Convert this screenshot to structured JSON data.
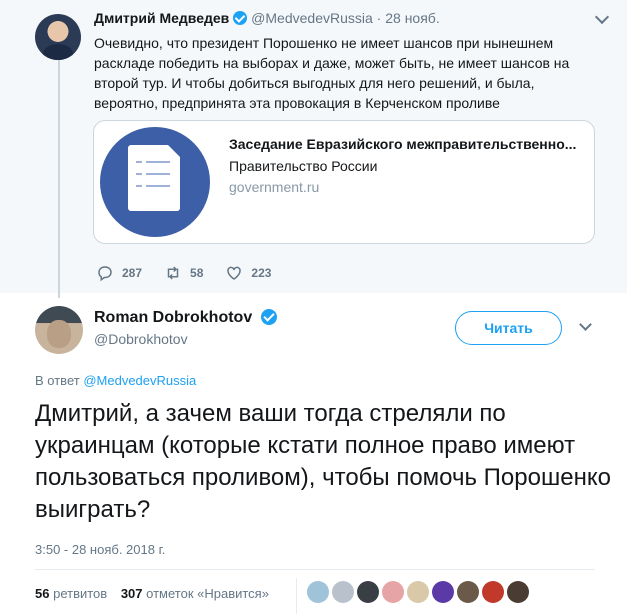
{
  "parent_tweet": {
    "name": "Дмитрий Медведев",
    "handle": "@MedvedevRussia",
    "separator": "·",
    "date": "28 нояб.",
    "text": "Очевидно, что президент Порошенко не имеет шансов при нынешнем раскладе победить на выборах и даже, может быть, не имеет шансов на второй тур. И чтобы добиться выгодных для него решений, и была, вероятно, предпринята эта провокация в Керченском проливе",
    "card": {
      "title": "Заседание Евразийского межправительственно...",
      "description": "Правительство России",
      "domain": "government.ru"
    },
    "actions": {
      "replies": "287",
      "retweets": "58",
      "likes": "223"
    }
  },
  "main_tweet": {
    "name": "Roman Dobrokhotov",
    "handle": "@Dobrokhotov",
    "follow_label": "Читать",
    "reply_prefix": "В ответ",
    "reply_to": "@MedvedevRussia",
    "text": "Дмитрий, а зачем ваши тогда стреляли по украинцам (которые кстати полное право имеют пользоваться проливом), чтобы помочь Порошенко выиграть?",
    "timestamp": "3:50 - 28 нояб. 2018 г.",
    "retweet_count": "56",
    "retweet_label": "ретвитов",
    "like_count": "307",
    "like_label": "отметок «Нравится»"
  },
  "colors": {
    "accent": "#1da1f2",
    "muted": "#657786",
    "parent_bg": "#f5f8fa",
    "card_image": "#3d5fa7"
  },
  "likers": [
    {
      "icon": "avatar-1",
      "color": "#9fc3d8"
    },
    {
      "icon": "avatar-2",
      "color": "#b9c2cc"
    },
    {
      "icon": "avatar-3",
      "color": "#3a3f45"
    },
    {
      "icon": "avatar-4",
      "color": "#e7a4a4"
    },
    {
      "icon": "avatar-5",
      "color": "#d9c9a8"
    },
    {
      "icon": "avatar-6",
      "color": "#5b3aa8"
    },
    {
      "icon": "avatar-7",
      "color": "#6b5a4a"
    },
    {
      "icon": "avatar-8",
      "color": "#c0392b"
    },
    {
      "icon": "avatar-9",
      "color": "#4a3b33"
    }
  ]
}
